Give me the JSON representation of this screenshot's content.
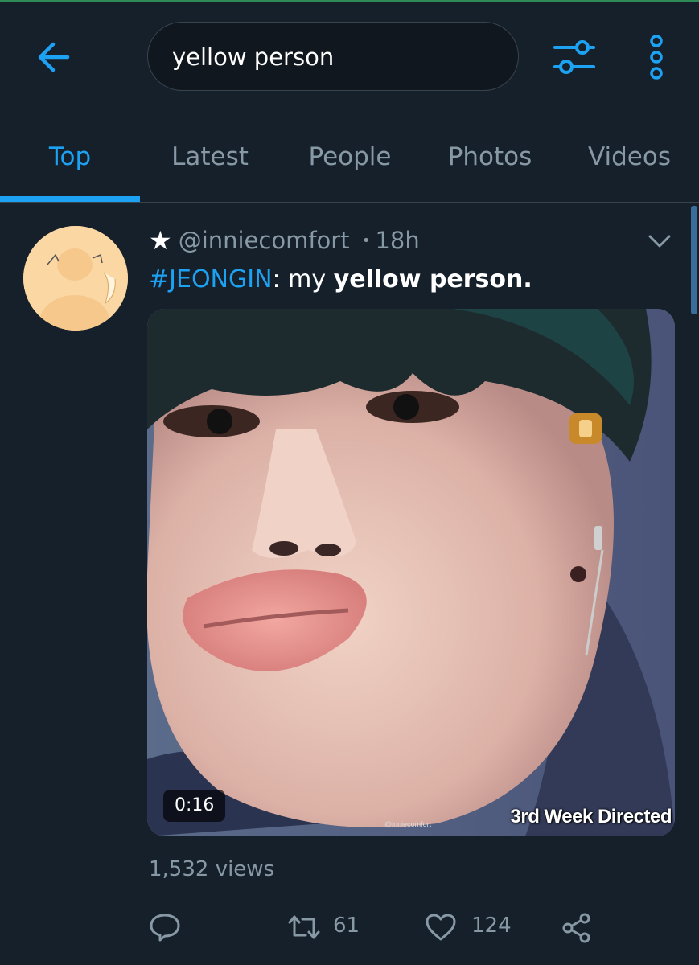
{
  "search": {
    "query": "yellow person"
  },
  "tabs": [
    {
      "label": "Top",
      "active": true
    },
    {
      "label": "Latest",
      "active": false
    },
    {
      "label": "People",
      "active": false
    },
    {
      "label": "Photos",
      "active": false
    },
    {
      "label": "Videos",
      "active": false
    }
  ],
  "tweet": {
    "star": "★",
    "handle": "@inniecomfort",
    "separator": "•",
    "time": "18h",
    "hashtag": "#JEONGIN",
    "text_mid": ": my ",
    "text_bold": "yellow person",
    "text_end": ".",
    "media": {
      "duration": "0:16",
      "overlay_caption": "3rd Week Directed",
      "watermark": "@inniecomfort"
    },
    "views": "1,532 views",
    "retweets": "61",
    "likes": "124"
  },
  "colors": {
    "background": "#15202b",
    "accent": "#1da1f2",
    "secondary_text": "#8899a6",
    "divider": "#38444d"
  },
  "icons": {
    "back": "arrow-left-icon",
    "filter": "sliders-icon",
    "more": "vertical-dots-icon",
    "caret": "chevron-down-icon",
    "reply": "speech-bubble-icon",
    "retweet": "retweet-icon",
    "like": "heart-icon",
    "share": "share-icon"
  }
}
